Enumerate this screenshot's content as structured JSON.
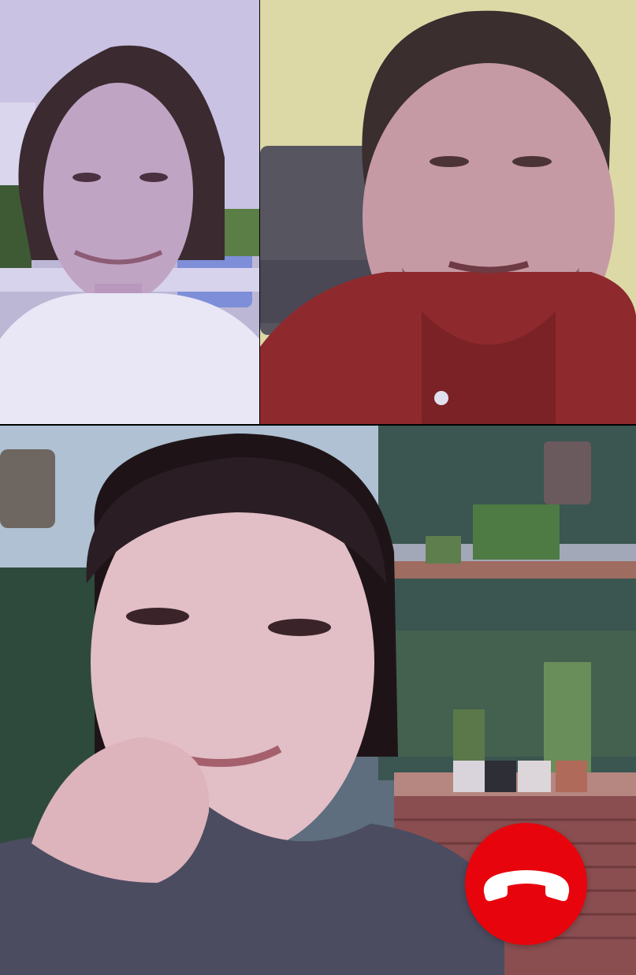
{
  "call": {
    "participants": [
      {
        "id": "participant-1"
      },
      {
        "id": "participant-2"
      },
      {
        "id": "participant-3"
      }
    ],
    "end_call_button": {
      "icon": "phone-hangup-icon",
      "color": "#E8040C",
      "icon_color": "#FFFFFF"
    }
  }
}
